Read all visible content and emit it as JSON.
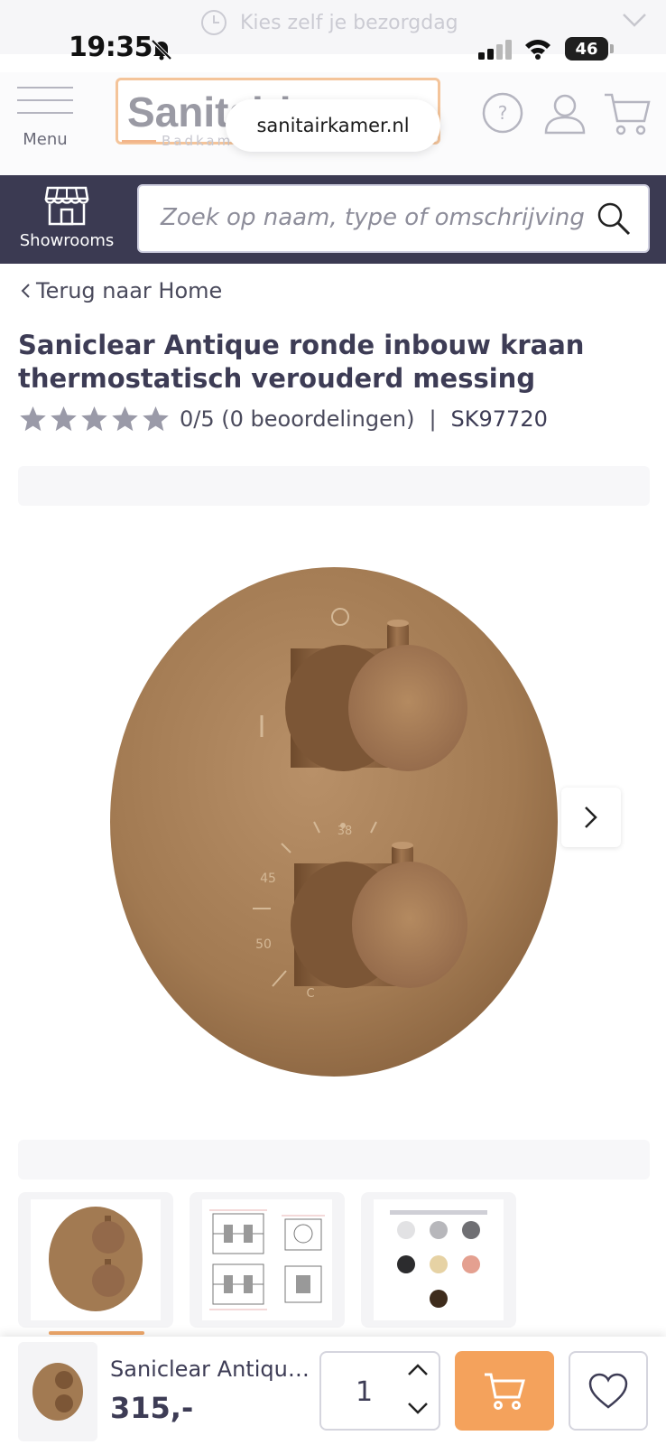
{
  "promo": {
    "text": "Kies zelf je bezorgdag"
  },
  "status_bar": {
    "time": "19:35",
    "battery": "46"
  },
  "header": {
    "menu_label": "Menu",
    "logo_text": "Sanitairkamer",
    "logo_tagline": "Badkamer",
    "url": "sanitairkamer.nl"
  },
  "search": {
    "showrooms_label": "Showrooms",
    "placeholder": "Zoek op naam, type of omschrijving"
  },
  "breadcrumb": {
    "back_label": "Terug naar Home"
  },
  "product": {
    "title": "Saniclear Antique ronde inbouw kraan thermostatisch verouderd messing",
    "rating_text": "0/5 (0 beoordelingen)",
    "rating_value": 0,
    "rating_max": 5,
    "separator": "|",
    "sku": "SK97720",
    "dial_marks": [
      "38",
      "45",
      "50",
      "C"
    ]
  },
  "sticky_bar": {
    "name": "Saniclear Antique ronde inbouw kraan thermostatisch verouderd messing",
    "price": "315,-",
    "quantity": "1"
  },
  "colors": {
    "brand_dark": "#3b3a52",
    "accent_orange": "#f4a25c",
    "brass": "#a27a52"
  }
}
